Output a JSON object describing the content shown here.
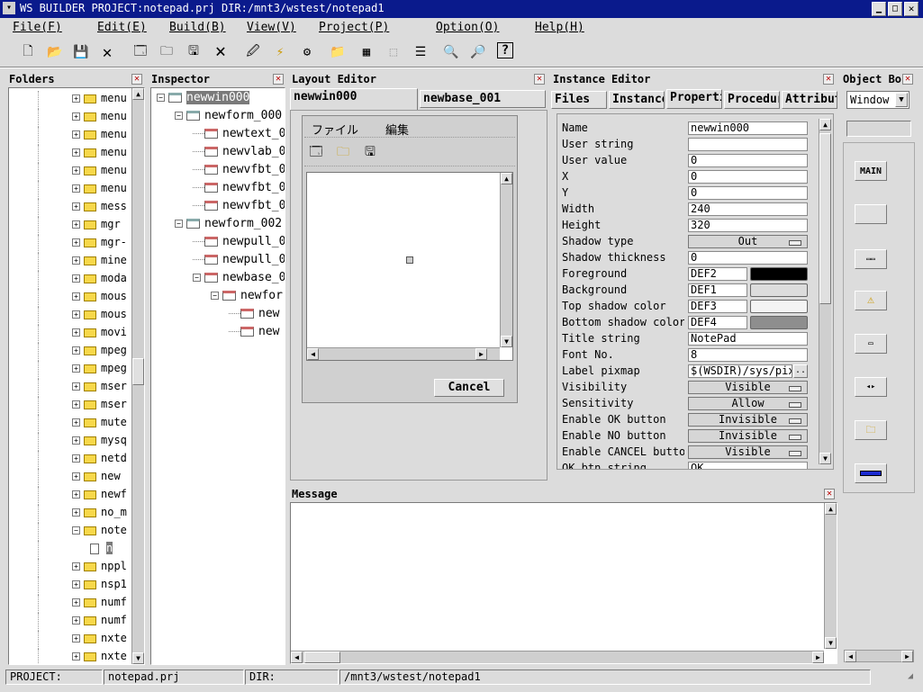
{
  "window": {
    "title": "WS BUILDER PROJECT:notepad.prj DIR:/mnt3/wstest/notepad1"
  },
  "menubar": [
    {
      "label": "File(F)"
    },
    {
      "label": "Edit(E)"
    },
    {
      "label": "Build(B)"
    },
    {
      "label": "View(V)"
    },
    {
      "label": "Project(P)"
    },
    {
      "label": "Option(O)"
    },
    {
      "label": "Help(H)"
    }
  ],
  "panels": {
    "folders": "Folders",
    "inspector": "Inspector",
    "layout": "Layout Editor",
    "instance": "Instance Editor",
    "object": "Object Bo",
    "message": "Message"
  },
  "folders": [
    "menu",
    "menu",
    "menu",
    "menu",
    "menu",
    "menu",
    "mess",
    "mgr",
    "mgr-",
    "mine",
    "moda",
    "mous",
    "mous",
    "movi",
    "mpeg",
    "mpeg",
    "mser",
    "mser",
    "mute",
    "mysq",
    "netd",
    "new",
    "newf",
    "no_m",
    "note",
    "n",
    "nppl",
    "nsp1",
    "numf",
    "numf",
    "nxte",
    "nxte"
  ],
  "inspector": [
    {
      "label": "newwin000",
      "depth": 0
    },
    {
      "label": "newform_000",
      "depth": 1
    },
    {
      "label": "newtext_0",
      "depth": 2
    },
    {
      "label": "newvlab_0",
      "depth": 2
    },
    {
      "label": "newvfbt_0",
      "depth": 2
    },
    {
      "label": "newvfbt_0",
      "depth": 2
    },
    {
      "label": "newvfbt_0",
      "depth": 2
    },
    {
      "label": "newform_002",
      "depth": 1
    },
    {
      "label": "newpull_0",
      "depth": 2
    },
    {
      "label": "newpull_0",
      "depth": 2
    },
    {
      "label": "newbase_0",
      "depth": 2
    },
    {
      "label": "newfor",
      "depth": 3
    },
    {
      "label": "new",
      "depth": 4
    },
    {
      "label": "new",
      "depth": 4
    }
  ],
  "layout": {
    "tabs": [
      "newwin000",
      "newbase_001"
    ],
    "menu": [
      "ファイル",
      "編集"
    ],
    "cancel": "Cancel"
  },
  "instance": {
    "tabs": [
      "Files",
      "Instance",
      "Properti",
      "Procedur",
      "Attribut"
    ],
    "props": [
      {
        "label": "Name",
        "value": "newwin000",
        "type": "text"
      },
      {
        "label": "User string",
        "value": "",
        "type": "text"
      },
      {
        "label": "User value",
        "value": "0",
        "type": "text"
      },
      {
        "label": "X",
        "value": "0",
        "type": "text"
      },
      {
        "label": "Y",
        "value": "0",
        "type": "text"
      },
      {
        "label": "Width",
        "value": "240",
        "type": "text"
      },
      {
        "label": "Height",
        "value": "320",
        "type": "text"
      },
      {
        "label": "Shadow type",
        "value": "Out",
        "type": "select"
      },
      {
        "label": "Shadow thickness",
        "value": "0",
        "type": "text"
      },
      {
        "label": "Foreground",
        "value": "DEF2",
        "type": "color",
        "swatch": "#000000"
      },
      {
        "label": "Background",
        "value": "DEF1",
        "type": "color",
        "swatch": "#dcdcdc"
      },
      {
        "label": "Top shadow color",
        "value": "DEF3",
        "type": "color",
        "swatch": "#f4f4f4"
      },
      {
        "label": "Bottom shadow color",
        "value": "DEF4",
        "type": "color",
        "swatch": "#8e8e8e"
      },
      {
        "label": "Title string",
        "value": "NotePad",
        "type": "text"
      },
      {
        "label": "Font No.",
        "value": "8",
        "type": "text"
      },
      {
        "label": "Label pixmap",
        "value": "$(WSDIR)/sys/pixm",
        "type": "file"
      },
      {
        "label": "Visibility",
        "value": "Visible",
        "type": "select"
      },
      {
        "label": "Sensitivity",
        "value": "Allow",
        "type": "select"
      },
      {
        "label": "Enable OK button",
        "value": "Invisible",
        "type": "select"
      },
      {
        "label": "Enable NO button",
        "value": "Invisible",
        "type": "select"
      },
      {
        "label": "Enable CANCEL button",
        "value": "Visible",
        "type": "select"
      },
      {
        "label": "OK btn string",
        "value": "OK",
        "type": "text"
      }
    ]
  },
  "objectbox": {
    "select": "Window",
    "main_label": "MAIN"
  },
  "status": {
    "project_label": "PROJECT:",
    "project_value": "notepad.prj",
    "dir_label": "DIR:",
    "dir_value": "/mnt3/wstest/notepad1"
  }
}
